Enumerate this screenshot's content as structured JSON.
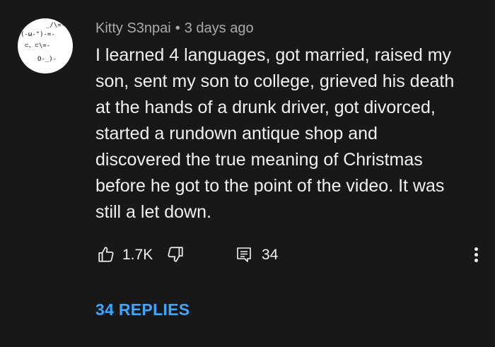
{
  "comment": {
    "author": "Kitty S3npai",
    "separator": "•",
    "timestamp": "3 days ago",
    "avatar_art": [
      "_/\\=-",
      "(-ω-\")-=-",
      "⊂、⊂\\=-",
      "O-_)-"
    ],
    "text_lines": [
      "I learned 4 languages, got married, raised my",
      "son, sent my son to college, grieved his death",
      "at the hands of a drunk driver, got divorced,",
      "started a rundown antique shop and",
      "discovered the true meaning of Christmas",
      "before he got to the point of the video. It was",
      "still a let down."
    ],
    "actions": {
      "like_icon": "thumbs-up-icon",
      "like_count": "1.7K",
      "dislike_icon": "thumbs-down-icon",
      "reply_icon": "comment-icon",
      "reply_count": "34",
      "more_icon": "more-vertical-icon"
    },
    "replies_label": "34 REPLIES",
    "colors": {
      "background": "#181818",
      "text": "#f1f1f1",
      "meta": "#aaaaaa",
      "link": "#3ea6ff"
    }
  }
}
